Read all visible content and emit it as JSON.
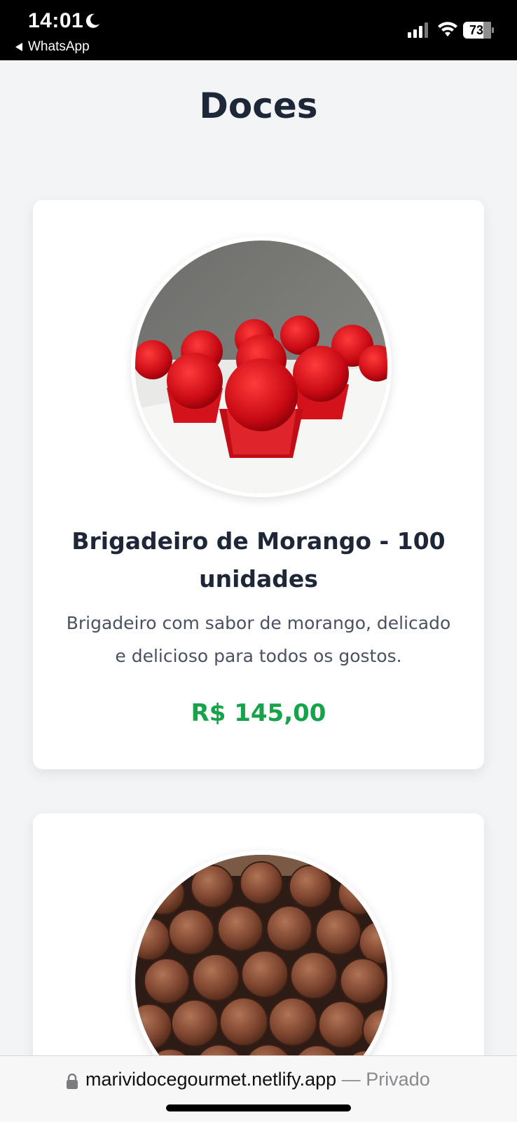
{
  "status_bar": {
    "time": "14:01",
    "back_app": "WhatsApp",
    "battery": "73",
    "icons": [
      "moon-icon",
      "signal-icon",
      "wifi-icon",
      "battery-icon"
    ]
  },
  "page": {
    "title": "Doces"
  },
  "products": [
    {
      "name": "Brigadeiro de Morango - 100 unidades",
      "description": "Brigadeiro com sabor de morango, delicado e delicioso para todos os gostos.",
      "price": "R$ 145,00"
    }
  ],
  "browser": {
    "url": "marividocegourmet.netlify.app",
    "separator": " — ",
    "mode": "Privado"
  },
  "colors": {
    "title": "#1d2738",
    "price": "#17a34a",
    "background": "#f2f4f6"
  }
}
